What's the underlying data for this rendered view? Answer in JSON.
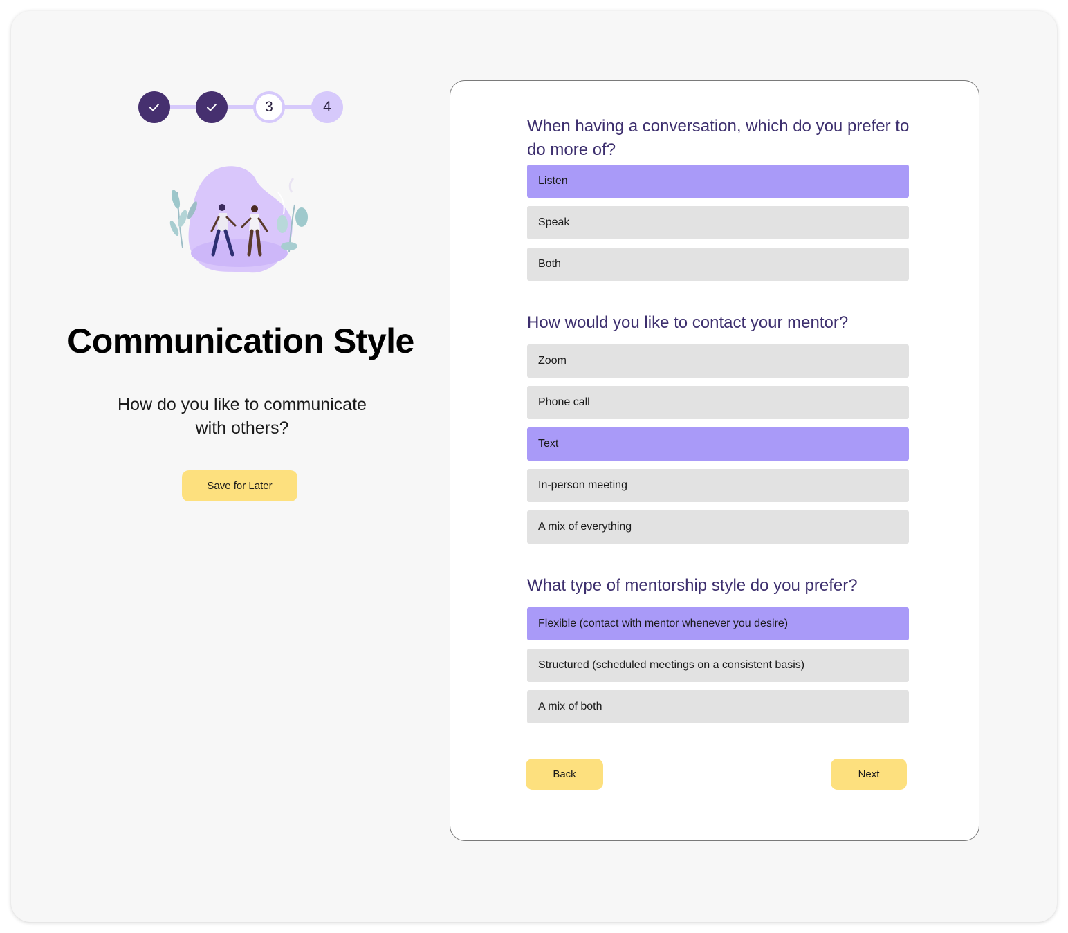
{
  "stepper": {
    "steps": [
      {
        "label": "",
        "state": "done"
      },
      {
        "label": "",
        "state": "done"
      },
      {
        "label": "3",
        "state": "current"
      },
      {
        "label": "4",
        "state": "todo"
      }
    ]
  },
  "intro": {
    "title": "Communication Style",
    "subtitle": "How do you like to communicate with others?",
    "save_label": "Save for Later"
  },
  "questions": [
    {
      "text": "When having a conversation, which do you prefer to do more of?",
      "options": [
        "Listen",
        "Speak",
        "Both"
      ],
      "selected": "Listen"
    },
    {
      "text": "How would you like to contact your mentor?",
      "options": [
        "Zoom",
        "Phone call",
        "Text",
        "In-person meeting",
        "A mix of everything"
      ],
      "selected": "Text"
    },
    {
      "text": "What type of mentorship style do you prefer?",
      "options": [
        "Flexible (contact with mentor whenever you desire)",
        "Structured (scheduled meetings on a consistent basis)",
        "A mix of both"
      ],
      "selected": "Flexible (contact with mentor whenever you desire)"
    }
  ],
  "nav": {
    "back_label": "Back",
    "next_label": "Next"
  },
  "colors": {
    "selected_option": "#a99af8",
    "unselected_option": "#e2e2e2",
    "accent_yellow": "#fde07e",
    "step_done": "#46306f",
    "step_light": "#d6c9fb",
    "question_text": "#3d2f6e"
  }
}
